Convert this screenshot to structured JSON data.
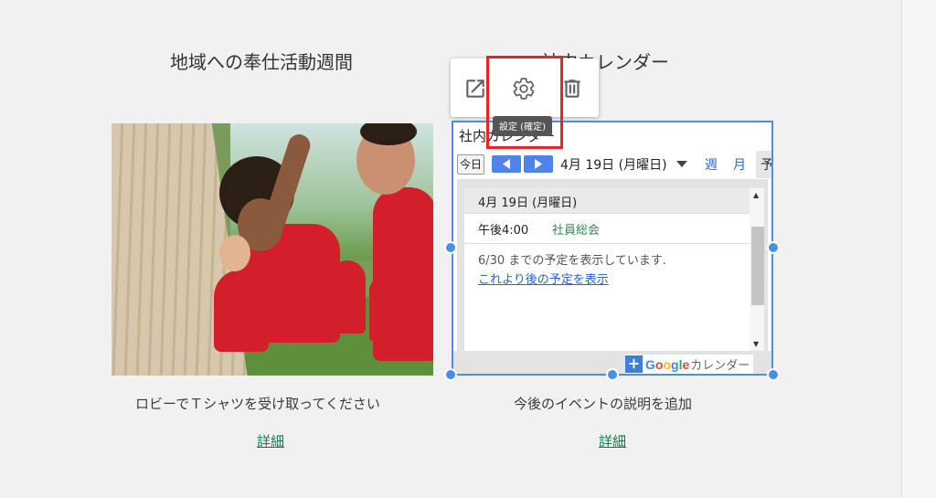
{
  "left_section": {
    "title": "地域への奉仕活動週間",
    "image_alt": "volunteers-raising-wall",
    "caption": "ロビーでＴシャツを受け取ってください",
    "more_link": "詳細"
  },
  "right_section": {
    "title": "社内カレンダー",
    "caption": "今後のイベントの説明を追加",
    "more_link": "詳細"
  },
  "toolbar": {
    "open_icon": "open-in-new-icon",
    "settings_icon": "gear-icon",
    "delete_icon": "trash-icon",
    "tooltip": "設定 (確定)"
  },
  "calendar": {
    "title": "社内カレンダー",
    "today_label": "今日",
    "date_label": "4月 19日 (月曜日)",
    "view_week": "週",
    "view_month": "月",
    "view_agenda": "予",
    "day_header": "4月 19日 (月曜日)",
    "events": [
      {
        "time": "午後4:00",
        "name": "社員総会"
      }
    ],
    "range_text": "6/30 までの予定を表示しています.",
    "later_link": "これより後の予定を表示",
    "badge_google": "Google",
    "badge_suffix": "カレンダー"
  },
  "colors": {
    "accent": "#4a8ee8",
    "link_green": "#157a4d",
    "highlight_red": "#e8232a",
    "shirt_red": "#d21f2b"
  }
}
